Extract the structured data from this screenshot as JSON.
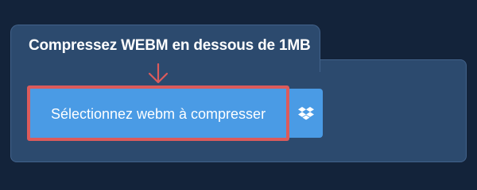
{
  "header": {
    "title": "Compressez WEBM en dessous de 1MB"
  },
  "upload": {
    "select_label": "Sélectionnez webm à compresser",
    "arrow_icon": "arrow-down-icon",
    "dropbox_icon": "dropbox-icon"
  },
  "colors": {
    "background": "#13233a",
    "panel": "#2c4a6e",
    "button": "#4a9be5",
    "highlight": "#dc5b5b"
  }
}
